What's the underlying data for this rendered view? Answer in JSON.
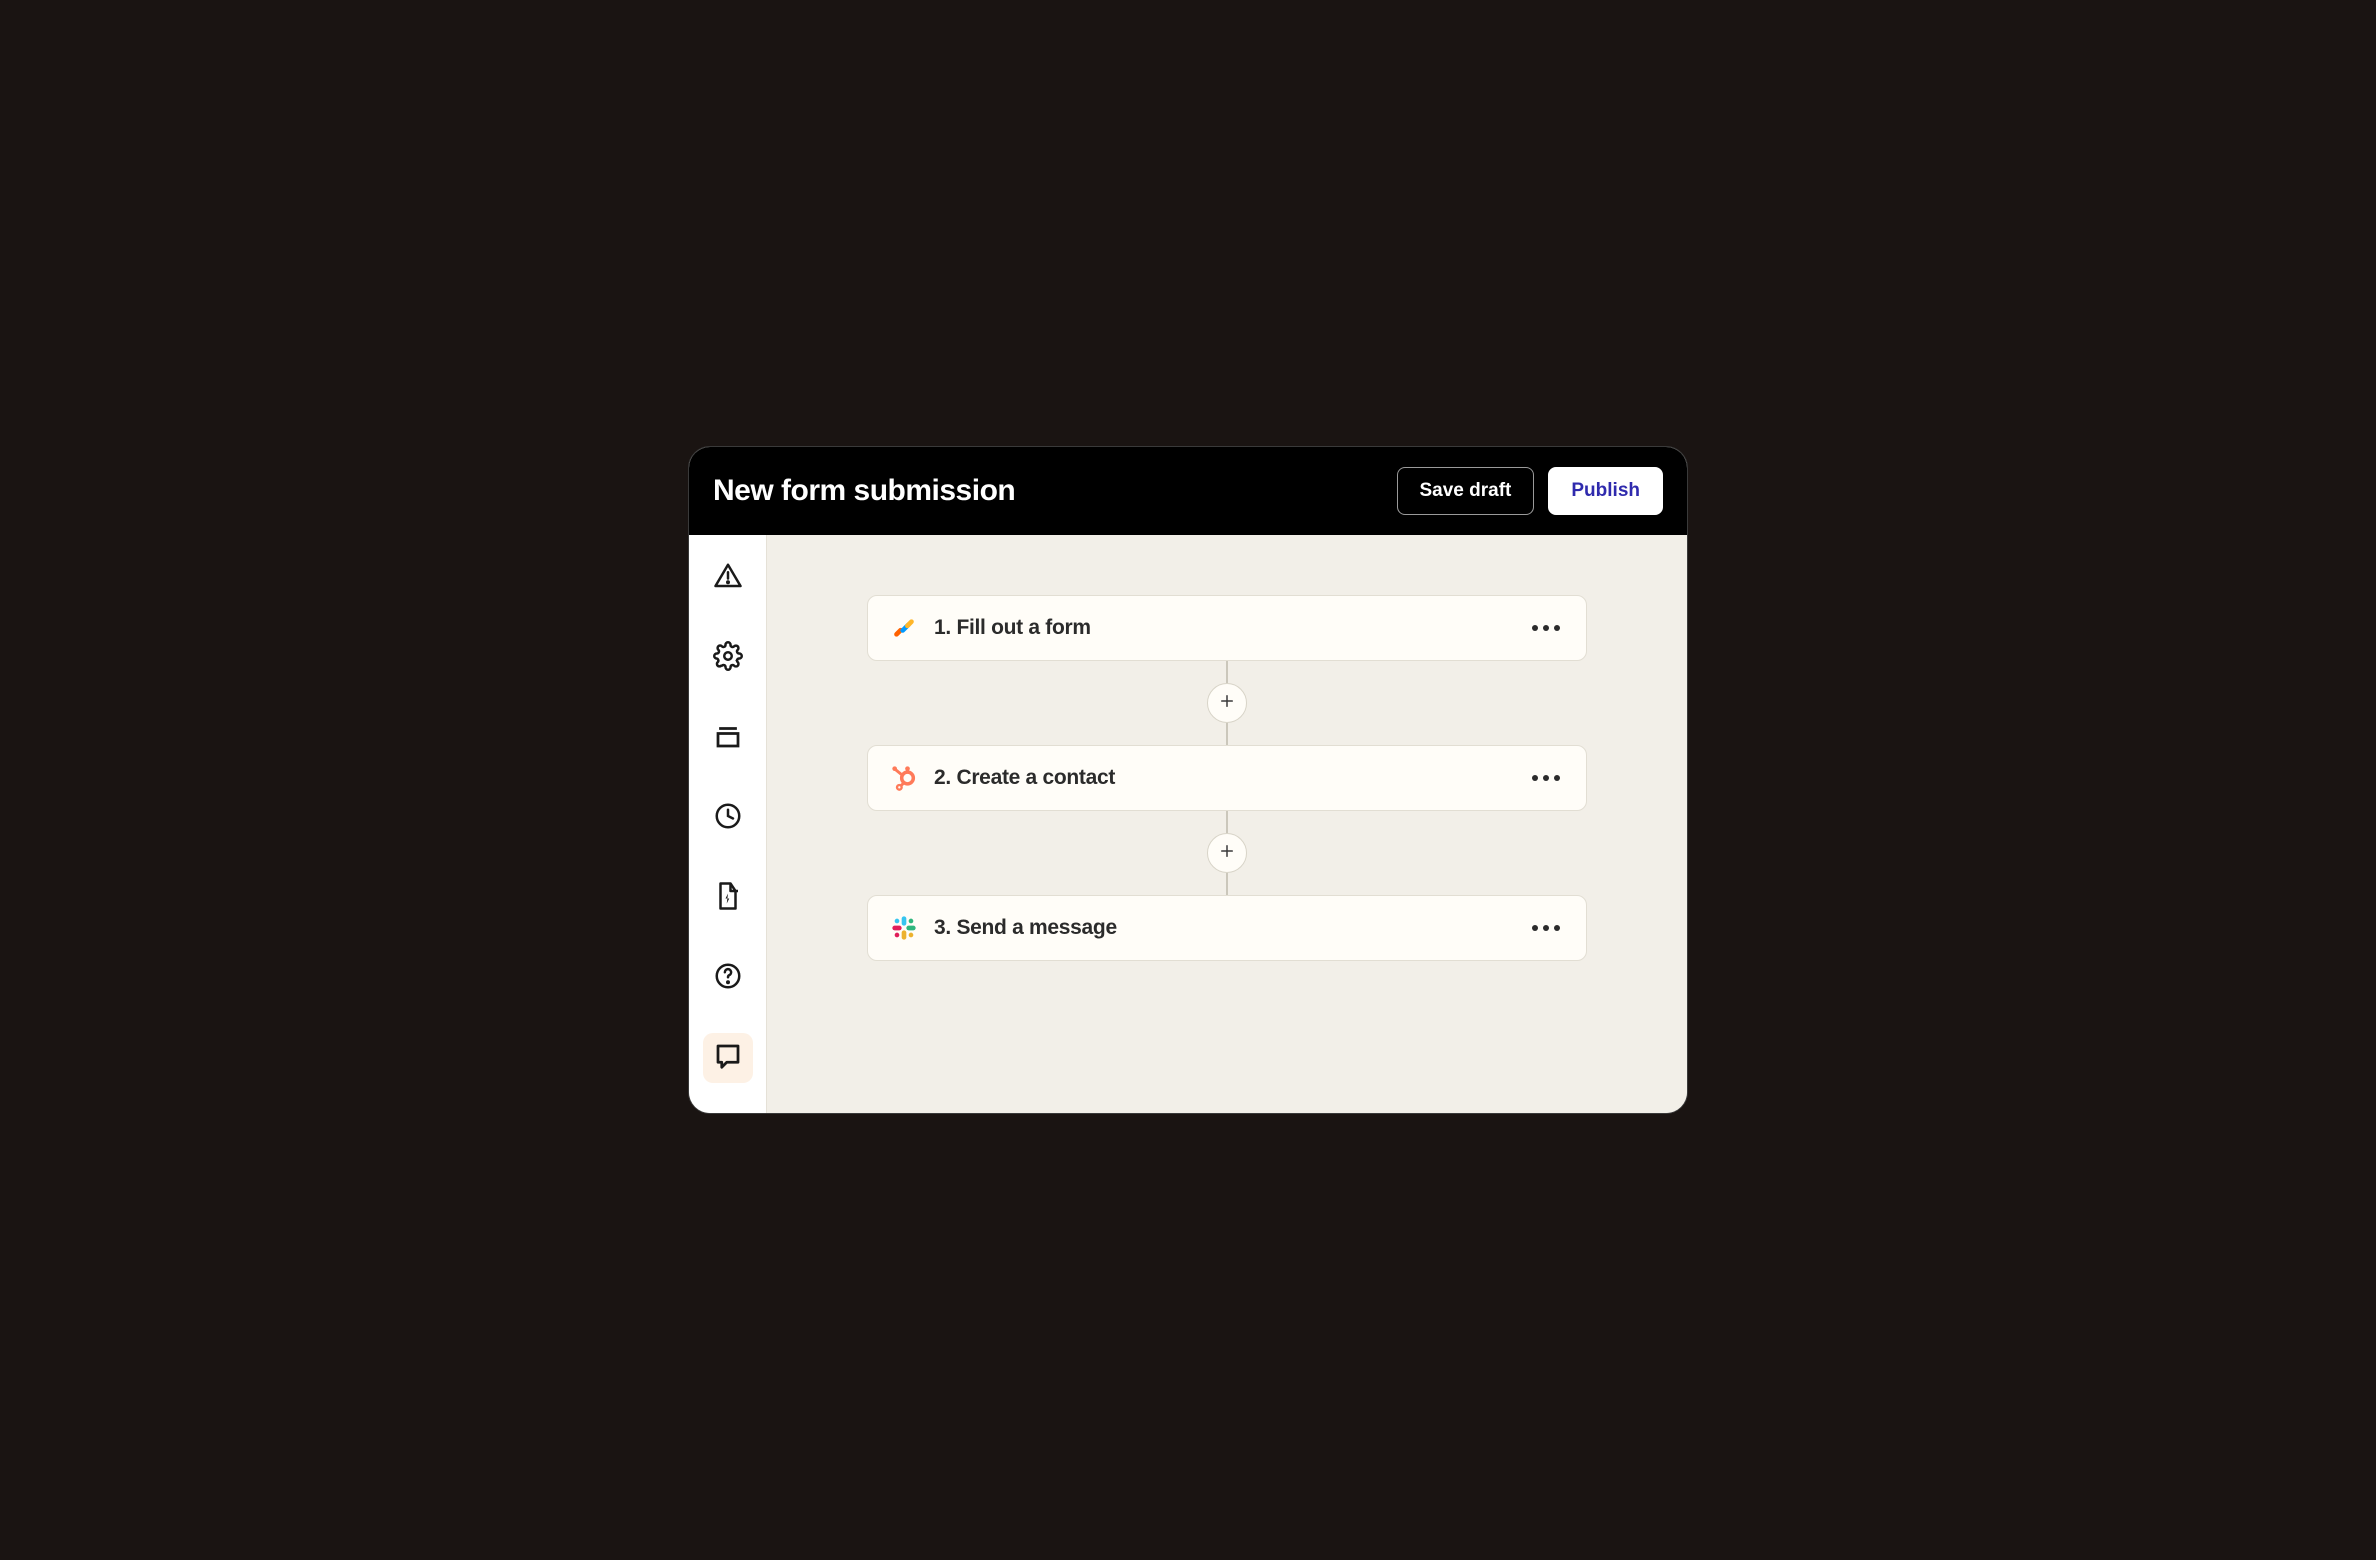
{
  "header": {
    "title": "New form submission",
    "save_label": "Save draft",
    "publish_label": "Publish"
  },
  "sidebar": {
    "items": [
      {
        "name": "alert",
        "icon": "alert-triangle-icon"
      },
      {
        "name": "settings",
        "icon": "gear-icon"
      },
      {
        "name": "stack",
        "icon": "stack-icon"
      },
      {
        "name": "history",
        "icon": "clock-icon"
      },
      {
        "name": "power",
        "icon": "file-bolt-icon"
      },
      {
        "name": "help",
        "icon": "help-circle-icon"
      },
      {
        "name": "comment",
        "icon": "comment-icon",
        "active": true
      }
    ]
  },
  "steps": [
    {
      "label": "1. Fill out a form",
      "app": "jotform"
    },
    {
      "label": "2. Create a contact",
      "app": "hubspot"
    },
    {
      "label": "3. Send a message",
      "app": "slack"
    }
  ],
  "add_label": "+"
}
